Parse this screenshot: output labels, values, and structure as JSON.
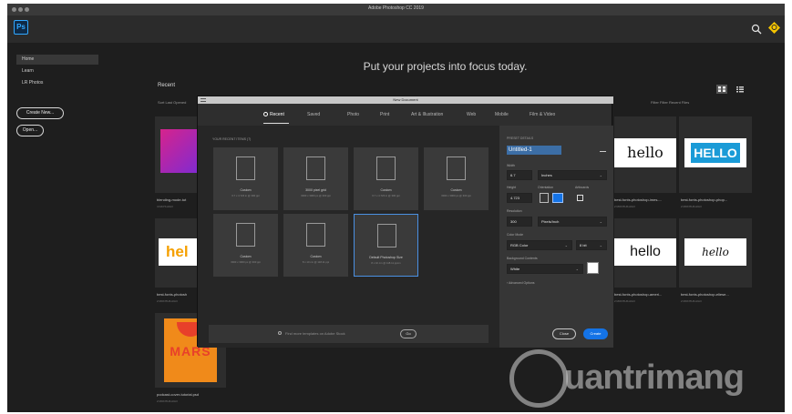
{
  "window": {
    "title": "Adobe Photoshop CC 2019"
  },
  "app": {
    "logo_text": "Ps"
  },
  "sidebar": {
    "items": [
      {
        "label": "Home"
      },
      {
        "label": "Learn"
      },
      {
        "label": "LR Photos"
      }
    ],
    "create_new_label": "Create New...",
    "open_label": "Open..."
  },
  "home": {
    "headline": "Put your projects into focus today.",
    "recent_label": "Recent",
    "sort_label": "Sort  Last Opened",
    "filter_label": "Filter  Filter Recent Files"
  },
  "recent_files": [
    {
      "name": "blending-mode-tut",
      "ago": "4 DAYS AGO"
    },
    {
      "name": "best-fonts-photoshop-imes-...",
      "ago": "2 MONTHS AGO",
      "thumb_text": "hello"
    },
    {
      "name": "best-fonts-photoshop-phop...",
      "ago": "2 MONTHS AGO",
      "thumb_text": "HELLO"
    },
    {
      "name": "best-fonts-photosh",
      "ago": "2 MONTHS AGO",
      "thumb_text": "hel"
    },
    {
      "name": "best-fonts-photoshop-ameri...",
      "ago": "2 MONTHS AGO",
      "thumb_text": "hello"
    },
    {
      "name": "best-fonts-photoshop-eliese...",
      "ago": "2 MONTHS AGO",
      "thumb_text": "hello"
    },
    {
      "name": "podcast-cover-tutorial.psd",
      "ago": "2 MONTHS AGO",
      "thumb_text": "MARS"
    }
  ],
  "dialog": {
    "title": "New Document",
    "tabs": [
      "Recent",
      "Saved",
      "Photo",
      "Print",
      "Art & Illustration",
      "Web",
      "Mobile",
      "Film & Video"
    ],
    "active_tab": "Recent",
    "section_label": "YOUR RECENT ITEMS  (7)",
    "presets": [
      {
        "name": "Custom",
        "size": "6.7 x 4.723 in @ 300 ppi"
      },
      {
        "name": "3000 pixel grid",
        "size": "3000 x 3000 px @ 300 ppi"
      },
      {
        "name": "Custom",
        "size": "6.7 x 4.723 in @ 300 ppi"
      },
      {
        "name": "Custom",
        "size": "3000 x 3000 px @ 300 ppi"
      },
      {
        "name": "Custom",
        "size": "3000 x 3000 px @ 300 ppi"
      },
      {
        "name": "Custom",
        "size": "8 x 10 cm @ 118.11 ppi"
      },
      {
        "name": "Default Photoshop Size",
        "size": "8 x 10 cm @ 118.11 ppcm"
      }
    ],
    "search_placeholder": "Find more templates on Adobe Stock",
    "go_label": "Go",
    "details": {
      "header": "PRESET DETAILS",
      "name_value": "Untitled-1",
      "width_label": "Width",
      "width_value": "6.7",
      "width_unit": "Inches",
      "height_label": "Height",
      "height_value": "4.723",
      "orientation_label": "Orientation",
      "artboards_label": "Artboards",
      "resolution_label": "Resolution",
      "resolution_value": "300",
      "resolution_unit": "Pixels/Inch",
      "color_mode_label": "Color Mode",
      "color_mode_value": "RGB Color",
      "bit_depth": "8 bit",
      "bg_label": "Background Contents",
      "bg_value": "White",
      "advanced_label": "Advanced Options",
      "close_label": "Close",
      "create_label": "Create"
    }
  },
  "watermark": {
    "text": "uantrimang"
  },
  "colors": {
    "background": "#1e1e1e",
    "accent": "#1473e6",
    "ps_blue": "#31a8ff"
  }
}
